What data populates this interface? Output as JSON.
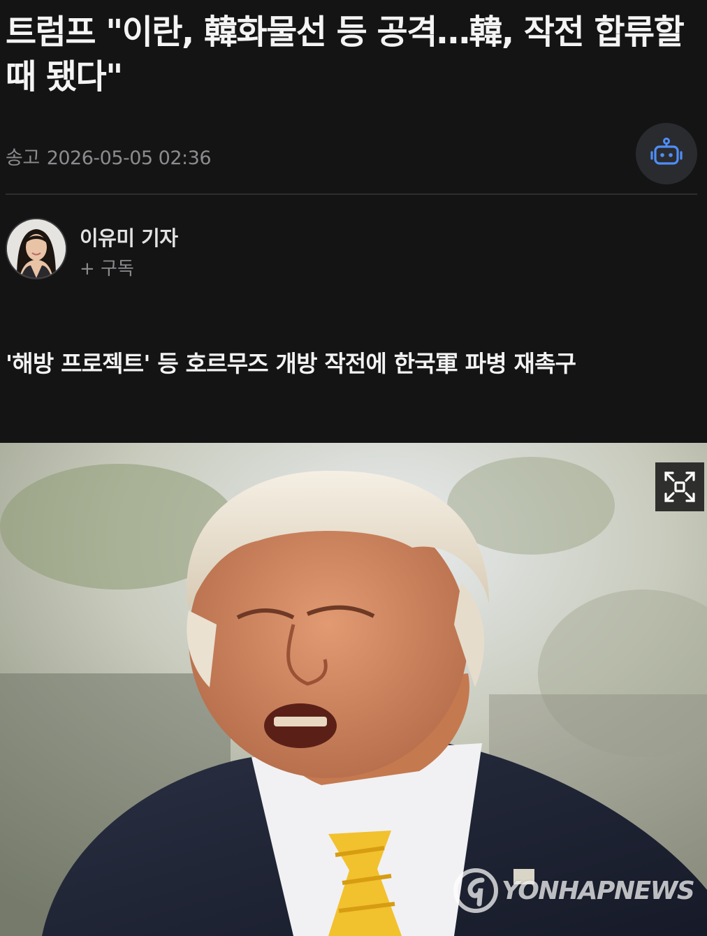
{
  "article": {
    "headline": "트럼프 \"이란, 韓화물선 등 공격…韓, 작전 합류할 때 됐다\"",
    "meta_label": "송고",
    "published": "2026-05-05 02:36",
    "subheadline": "'해방 프로젝트' 등 호르무즈 개방 작전에 한국軍 파병 재촉구"
  },
  "reporter": {
    "name": "이유미 기자",
    "subscribe_label": "+ 구독"
  },
  "toolbar": {
    "ai_bot_icon": "robot-icon"
  },
  "photo": {
    "expand_icon": "expand-icon",
    "watermark": "YONHAPNEWS"
  },
  "colors": {
    "background": "#141415",
    "accent": "#4f8ef7",
    "muted_text": "#8c8c8f"
  }
}
